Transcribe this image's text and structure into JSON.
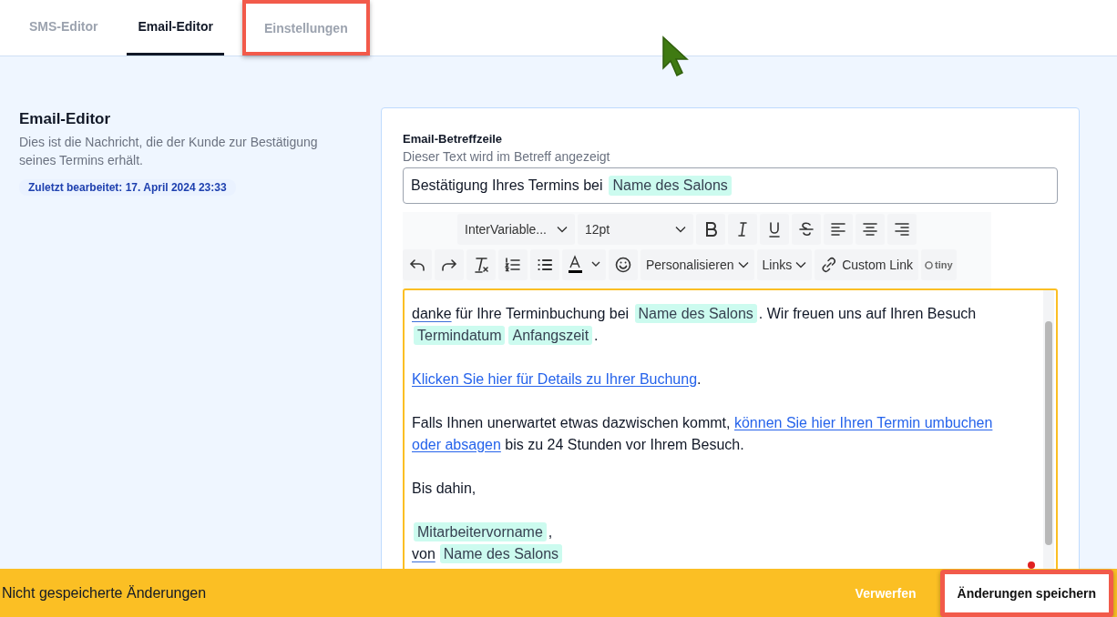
{
  "tabs": [
    {
      "label": "SMS-Editor",
      "selected": false,
      "highlighted": false
    },
    {
      "label": "Email-Editor",
      "selected": true,
      "highlighted": false
    },
    {
      "label": "Einstellungen",
      "selected": false,
      "highlighted": true
    }
  ],
  "intro": {
    "title": "Email-Editor",
    "description": "Dies ist die Nachricht, die der Kunde zur Bestätigung seines Termins erhält.",
    "last_edited": "Zuletzt bearbeitet: 17. April 2024 23:33"
  },
  "subject": {
    "label": "Email-Betreffzeile",
    "hint": "Dieser Text wird im Betreff angezeigt",
    "segments": [
      {
        "kind": "text",
        "text": "Bestätigung Ihres Termins bei"
      },
      {
        "kind": "chip",
        "text": "Name des Salons"
      }
    ]
  },
  "toolbar": {
    "rows": [
      [
        {
          "kind": "select",
          "label": "InterVariable..."
        },
        {
          "kind": "select",
          "label": "12pt"
        },
        {
          "kind": "bold"
        },
        {
          "kind": "italic"
        },
        {
          "kind": "underline"
        },
        {
          "kind": "strike"
        },
        {
          "kind": "align-left"
        },
        {
          "kind": "align-center"
        },
        {
          "kind": "align-right"
        }
      ],
      [
        {
          "kind": "undo"
        },
        {
          "kind": "redo"
        },
        {
          "kind": "clear-format"
        },
        {
          "kind": "numbered-list"
        },
        {
          "kind": "bullet-list"
        },
        {
          "kind": "text-color"
        },
        {
          "kind": "emoji"
        },
        {
          "kind": "menu",
          "label": "Personalisieren"
        },
        {
          "kind": "menu",
          "label": "Links"
        },
        {
          "kind": "link-button",
          "label": "Custom Link"
        },
        {
          "kind": "logo",
          "label": "tiny"
        }
      ]
    ]
  },
  "body": {
    "paragraphs": [
      [
        {
          "kind": "marked",
          "text": "danke"
        },
        {
          "kind": "text",
          "text": " für Ihre Terminbuchung bei "
        },
        {
          "kind": "chip",
          "text": "Name des Salons"
        },
        {
          "kind": "text",
          "text": ". Wir freuen uns auf Ihren Besuch"
        },
        {
          "kind": "break"
        },
        {
          "kind": "chip",
          "text": "Termindatum"
        },
        {
          "kind": "chip",
          "text": "Anfangszeit"
        },
        {
          "kind": "text",
          "text": "."
        }
      ],
      [
        {
          "kind": "link",
          "text": "Klicken Sie hier für Details zu Ihrer Buchung"
        },
        {
          "kind": "text",
          "text": "."
        }
      ],
      [
        {
          "kind": "text",
          "text": "Falls Ihnen unerwartet etwas dazwischen kommt, "
        },
        {
          "kind": "link",
          "text": "können Sie hier Ihren Termin umbuchen"
        },
        {
          "kind": "break"
        },
        {
          "kind": "link",
          "text": "oder absagen"
        },
        {
          "kind": "text",
          "text": " bis zu 24 Stunden vor Ihrem Besuch."
        }
      ],
      [
        {
          "kind": "text",
          "text": "Bis dahin,"
        }
      ],
      [
        {
          "kind": "chip",
          "text": "Mitarbeitervorname"
        },
        {
          "kind": "text",
          "text": ","
        },
        {
          "kind": "break"
        },
        {
          "kind": "marked",
          "text": "von"
        },
        {
          "kind": "chip",
          "text": "Name des Salons"
        }
      ]
    ]
  },
  "footer": {
    "message": "Nicht gespeicherte Änderungen",
    "discard": "Verwerfen",
    "save": {
      "label": "Änderungen speichern",
      "highlighted": true
    }
  }
}
